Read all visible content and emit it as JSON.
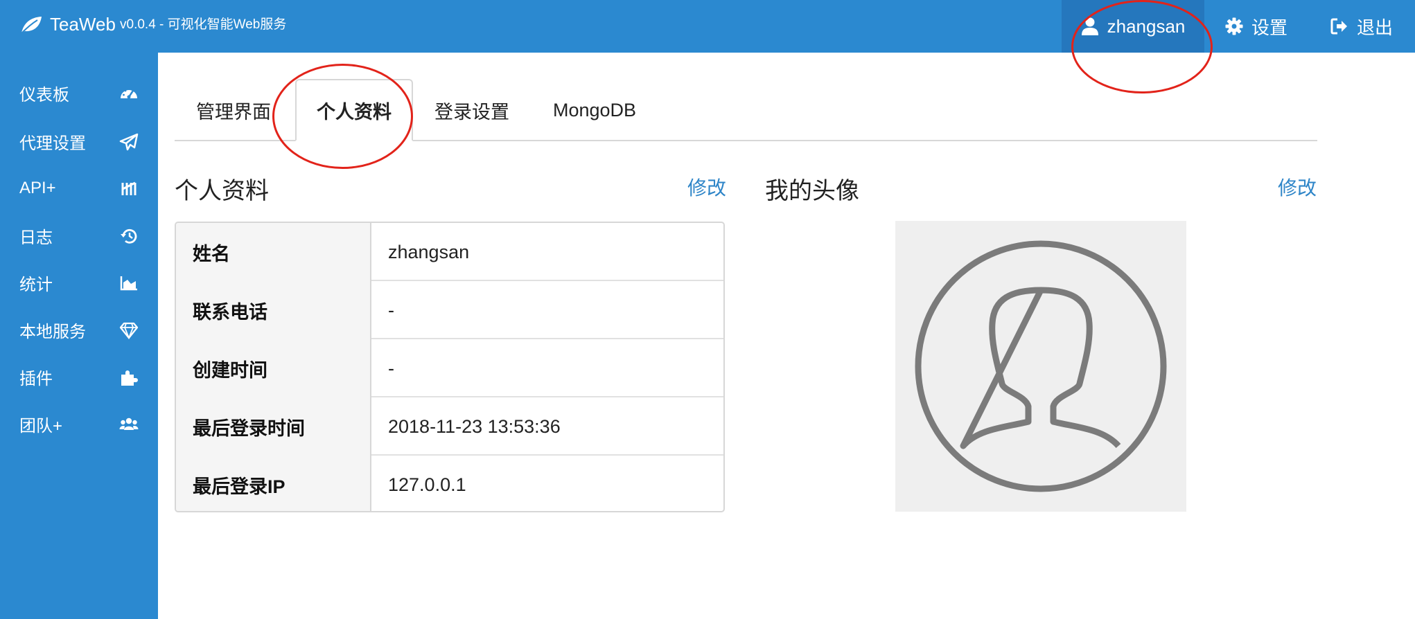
{
  "topbar": {
    "brand_name": "TeaWeb",
    "version": "v0.0.4 - 可视化智能Web服务",
    "user": {
      "label": "zhangsan",
      "icon": "user-icon"
    },
    "settings": {
      "label": "设置",
      "icon": "gear-icon"
    },
    "logout": {
      "label": "退出",
      "icon": "sign-out-icon"
    }
  },
  "sidebar": {
    "items": [
      {
        "label": "仪表板",
        "icon": "tachometer-icon"
      },
      {
        "label": "代理设置",
        "icon": "paper-plane-icon"
      },
      {
        "label": "API+",
        "icon": "api-icon"
      },
      {
        "label": "日志",
        "icon": "history-icon"
      },
      {
        "label": "统计",
        "icon": "area-chart-icon"
      },
      {
        "label": "本地服务",
        "icon": "diamond-icon"
      },
      {
        "label": "插件",
        "icon": "puzzle-icon"
      },
      {
        "label": "团队+",
        "icon": "users-icon"
      }
    ]
  },
  "tabs": [
    {
      "label": "管理界面",
      "active": false
    },
    {
      "label": "个人资料",
      "active": true
    },
    {
      "label": "登录设置",
      "active": false
    },
    {
      "label": "MongoDB",
      "active": false
    }
  ],
  "profile": {
    "title": "个人资料",
    "edit_label": "修改",
    "rows": [
      {
        "key": "姓名",
        "value": "zhangsan"
      },
      {
        "key": "联系电话",
        "value": "-"
      },
      {
        "key": "创建时间",
        "value": "-"
      },
      {
        "key": "最后登录时间",
        "value": "2018-11-23 13:53:36"
      },
      {
        "key": "最后登录IP",
        "value": "127.0.0.1"
      }
    ]
  },
  "avatar": {
    "title": "我的头像",
    "edit_label": "修改",
    "icon": "default-avatar-icon"
  },
  "colors": {
    "header_bg": "#2b89d0",
    "user_menu_bg": "#2577bd",
    "link": "#2e85c8",
    "annotation": "#e2231a"
  }
}
